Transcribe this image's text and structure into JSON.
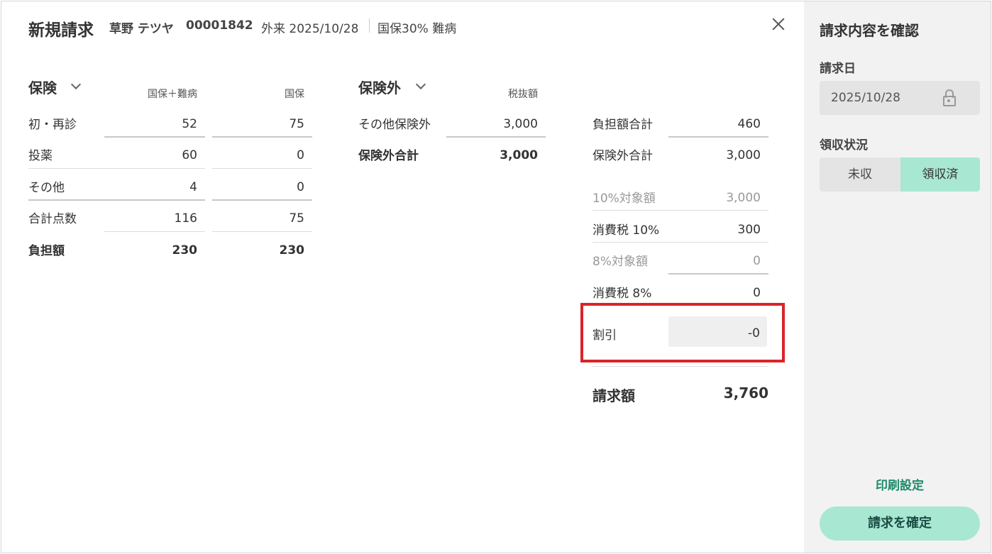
{
  "header": {
    "title": "新規請求",
    "patient_name": "草野 テツヤ",
    "patient_id": "00001842",
    "visit": "外来 2025/10/28",
    "insurance": "国保30% 難病"
  },
  "insurance_section": {
    "title": "保険",
    "col1": "国保＋難病",
    "col2": "国保",
    "rows": [
      {
        "label": "初・再診",
        "v1": "52",
        "v2": "75"
      },
      {
        "label": "投薬",
        "v1": "60",
        "v2": "0"
      },
      {
        "label": "その他",
        "v1": "4",
        "v2": "0"
      },
      {
        "label": "合計点数",
        "v1": "116",
        "v2": "75"
      },
      {
        "label": "負担額",
        "v1": "230",
        "v2": "230"
      }
    ]
  },
  "non_insurance_section": {
    "title": "保険外",
    "col": "税抜額",
    "rows": [
      {
        "label": "その他保険外",
        "value": "3,000"
      },
      {
        "label": "保険外合計",
        "value": "3,000"
      }
    ]
  },
  "summary": {
    "rows": [
      {
        "label": "負担額合計",
        "value": "460"
      },
      {
        "label": "保険外合計",
        "value": "3,000"
      },
      {
        "label": "10%対象額",
        "value": "3,000"
      },
      {
        "label": "消費税 10%",
        "value": "300"
      },
      {
        "label": "8%対象額",
        "value": "0"
      },
      {
        "label": "消費税 8%",
        "value": "0"
      }
    ],
    "discount_label": "割引",
    "discount_value": "-0",
    "total_label": "請求額",
    "total_value": "3,760"
  },
  "sidebar": {
    "title": "請求内容を確認",
    "date_label": "請求日",
    "date_value": "2025/10/28",
    "status_label": "領収状況",
    "status_options": [
      "未収",
      "領収済"
    ],
    "status_selected": "領収済",
    "print_link": "印刷設定",
    "confirm_button": "請求を確定"
  },
  "colors": {
    "accent": "#a8e7d2",
    "accent_text": "#1f8a6a",
    "highlight": "#d9242a"
  },
  "icons": [
    "close-icon",
    "chevron-down-icon",
    "lock-icon"
  ]
}
